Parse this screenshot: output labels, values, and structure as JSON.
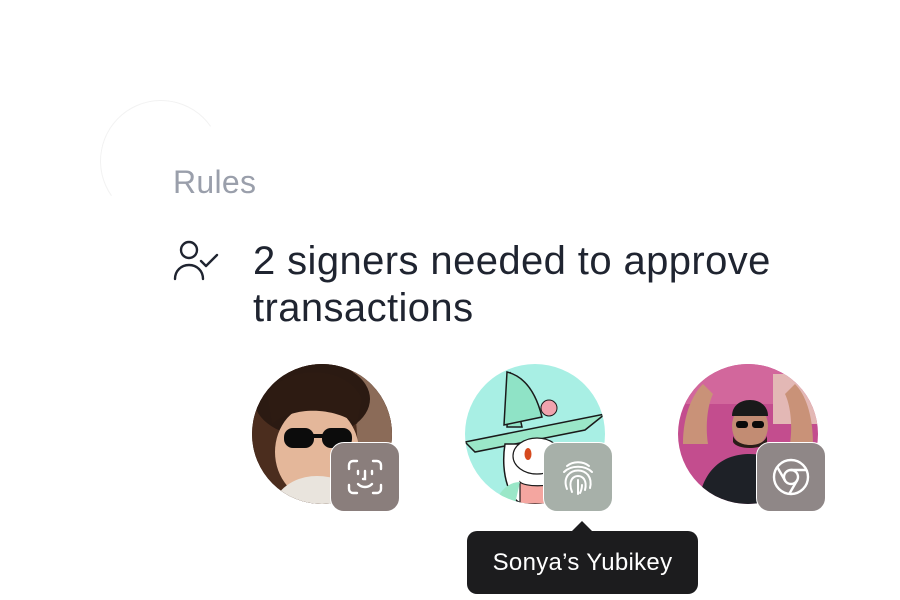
{
  "rules": {
    "title": "Rules",
    "rule_icon": "user-check-icon",
    "rule_text": "2 signers needed to approve transactions"
  },
  "signers": [
    {
      "avatar": "kid-sunglasses-avatar",
      "method_icon": "face-id-icon",
      "badge_color": "#8a7e7c"
    },
    {
      "avatar": "witch-rabbit-avatar",
      "method_icon": "fingerprint-icon",
      "badge_color": "#a7b0a9"
    },
    {
      "avatar": "man-sunglasses-avatar",
      "method_icon": "chrome-icon",
      "badge_color": "#8f8787"
    }
  ],
  "tooltip": {
    "label": "Sonya’s Yubikey"
  },
  "colors": {
    "title": "#9a9fab",
    "text": "#1f2430",
    "tooltip_bg": "#1c1c1e"
  }
}
